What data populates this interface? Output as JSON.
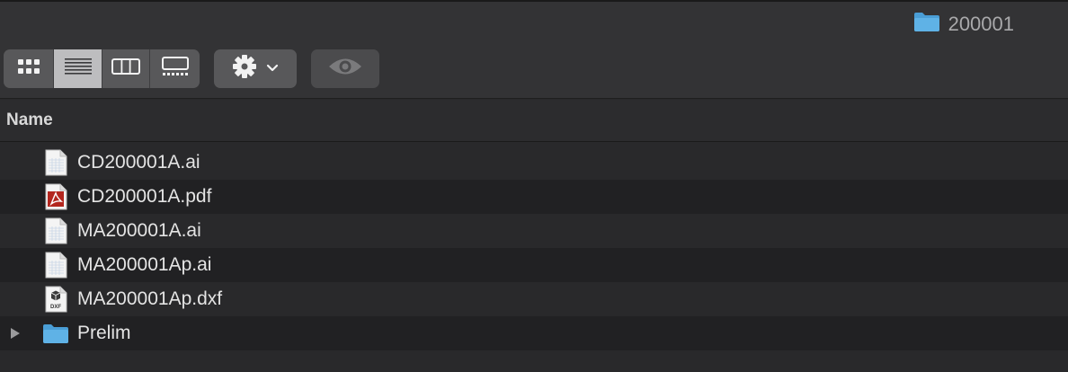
{
  "window": {
    "title": "200001",
    "title_icon": "folder-icon"
  },
  "toolbar": {
    "view_buttons": [
      {
        "name": "icon-view",
        "icon": "grid-icon",
        "active": false
      },
      {
        "name": "list-view",
        "icon": "list-icon",
        "active": true
      },
      {
        "name": "column-view",
        "icon": "columns-icon",
        "active": false
      },
      {
        "name": "gallery-view",
        "icon": "gallery-icon",
        "active": false
      }
    ],
    "action_icon": "gear-icon",
    "action_dropdown_icon": "chevron-down-icon",
    "quicklook_icon": "eye-icon"
  },
  "list": {
    "column_name": "Name",
    "items": [
      {
        "name": "CD200001A.ai",
        "icon": "document-icon",
        "expandable": false
      },
      {
        "name": "CD200001A.pdf",
        "icon": "pdf-icon",
        "expandable": false
      },
      {
        "name": "MA200001A.ai",
        "icon": "document-icon",
        "expandable": false
      },
      {
        "name": "MA200001Ap.ai",
        "icon": "document-icon",
        "expandable": false
      },
      {
        "name": "MA200001Ap.dxf",
        "icon": "dxf-icon",
        "icon_label": "DXF",
        "expandable": false
      },
      {
        "name": "Prelim",
        "icon": "folder-icon",
        "expandable": true
      }
    ]
  },
  "colors": {
    "folder_blue": "#5fb2e6",
    "pdf_red": "#b3261e"
  }
}
